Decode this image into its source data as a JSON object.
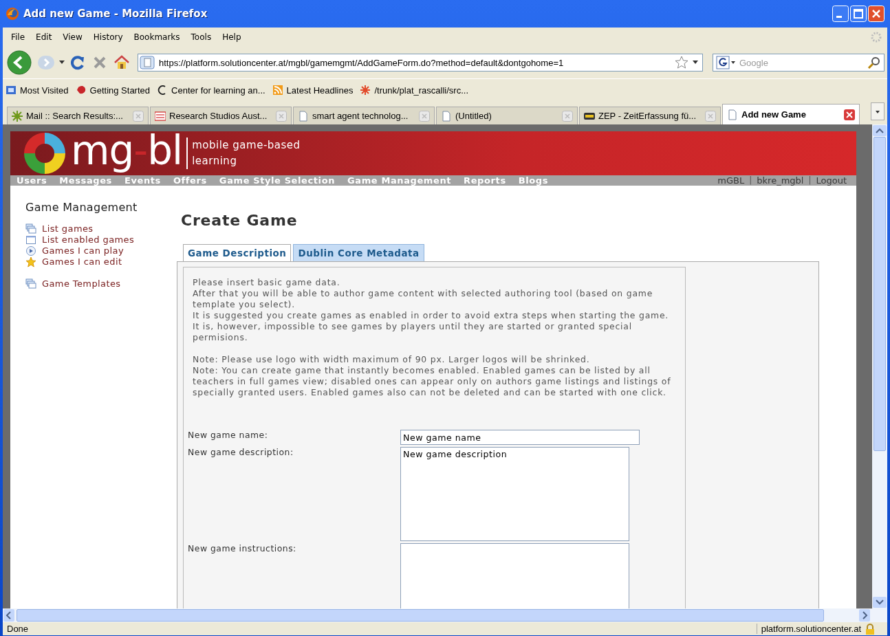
{
  "window": {
    "title": "Add new Game - Mozilla Firefox"
  },
  "menu": [
    "File",
    "Edit",
    "View",
    "History",
    "Bookmarks",
    "Tools",
    "Help"
  ],
  "address": {
    "url": "https://platform.solutioncenter.at/mgbl/gamemgmt/AddGameForm.do?method=default&dontgohome=1"
  },
  "search": {
    "placeholder": "Google"
  },
  "bookmarks": [
    "Most Visited",
    "Getting Started",
    "Center for learning an...",
    "Latest Headlines",
    "/trunk/plat_rascalli/src..."
  ],
  "browser_tabs": [
    {
      "label": "Mail :: Search Results:...",
      "selected": false
    },
    {
      "label": "Research Studios Aust...",
      "selected": false
    },
    {
      "label": "smart agent technolog...",
      "selected": false
    },
    {
      "label": "(Untitled)",
      "selected": false
    },
    {
      "label": "ZEP - ZeitErfassung fü...",
      "selected": false
    },
    {
      "label": "Add new Game",
      "selected": true
    }
  ],
  "site": {
    "logo_parts": [
      {
        "text": "mg",
        "accent": false
      },
      {
        "text": "-",
        "accent": true
      },
      {
        "text": "bl",
        "accent": false
      }
    ],
    "tagline": [
      "mobile game-based",
      "learning"
    ],
    "nav": [
      "Users",
      "Messages",
      "Events",
      "Offers",
      "Game Style Selection",
      "Game Management",
      "Reports",
      "Blogs"
    ],
    "user_bar": [
      {
        "kind": "link",
        "text": "mGBL"
      },
      {
        "kind": "separator",
        "text": "|"
      },
      {
        "kind": "link",
        "text": "bkre_mgbl"
      },
      {
        "kind": "separator",
        "text": "|"
      },
      {
        "kind": "link",
        "text": "Logout"
      }
    ]
  },
  "sidebar": {
    "title": "Game Management",
    "groups": [
      [
        "List games",
        "List enabled games",
        "Games I can play",
        "Games I can edit"
      ],
      [
        "Game Templates"
      ]
    ]
  },
  "page": {
    "heading": "Create Game",
    "tabs": [
      {
        "label": "Game Description",
        "selected": true
      },
      {
        "label": "Dublin Core Metadata",
        "selected": false
      }
    ],
    "intro": [
      "Please insert basic game data.",
      "After that you will be able to author game content with selected authoring tool (based on game template you select).",
      "It is suggested you create games as enabled in order to avoid extra steps when starting the game.",
      "It is, however, impossible to see games by players until they are started or granted special permisions."
    ],
    "notes": [
      "Note: Please use logo with width maximum of 90 px. Larger logos will be shrinked.",
      "Note: You can create game that instantly becomes enabled. Enabled games can be listed by all teachers in full games view; disabled ones can appear only on authors game listings and listings of specially granted users. Enabled games also can not be deleted and can be started with one click."
    ],
    "fields": [
      {
        "label": "New game name:",
        "kind": "input",
        "value": "New game name"
      },
      {
        "label": "New game description:",
        "kind": "textarea",
        "value": "New game description"
      },
      {
        "label": "New game instructions:",
        "kind": "textarea"
      }
    ]
  },
  "status_bar": {
    "text": "Done",
    "host": "platform.solutioncenter.at"
  }
}
